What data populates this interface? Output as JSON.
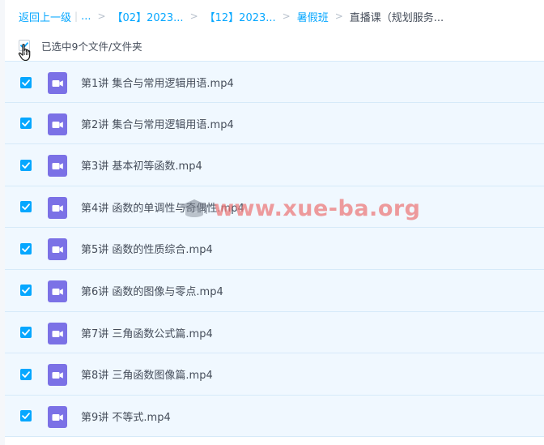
{
  "breadcrumb": {
    "back": "返回上一级",
    "ellipsis": "...",
    "items": [
      "【02】2023...",
      "【12】2023...",
      "暑假班"
    ],
    "current": "直播课（规划服务..."
  },
  "selection": {
    "text": "已选中9个文件/文件夹"
  },
  "files": [
    {
      "name": "第1讲 集合与常用逻辑用语.mp4"
    },
    {
      "name": "第2讲 集合与常用逻辑用语.mp4"
    },
    {
      "name": "第3讲 基本初等函数.mp4"
    },
    {
      "name": "第4讲 函数的单调性与奇偶性.mp4"
    },
    {
      "name": "第5讲 函数的性质综合.mp4"
    },
    {
      "name": "第6讲 函数的图像与零点.mp4"
    },
    {
      "name": "第7讲 三角函数公式篇.mp4"
    },
    {
      "name": "第8讲 三角函数图像篇.mp4"
    },
    {
      "name": "第9讲 不等式.mp4"
    }
  ],
  "watermark": {
    "text": "www.xue-ba.org"
  },
  "colors": {
    "accent": "#06a7ff",
    "row_selected": "#f0f8ff",
    "video_icon": "#7b71e6"
  },
  "icons": {
    "file": "video-file-icon",
    "checkbox": "checkmark-icon",
    "cursor": "hand-pointer-icon"
  }
}
